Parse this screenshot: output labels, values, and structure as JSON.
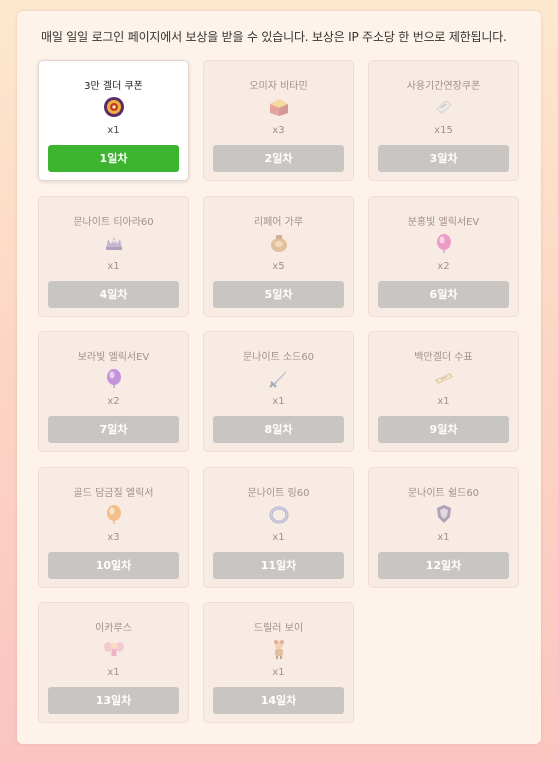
{
  "notice": "매일 일일 로그인 페이지에서 보상을 받을 수 있습니다. 보상은 IP 주소당 한 번으로 제한됩니다.",
  "colors": {
    "active_button": "#3cb430",
    "inactive_button": "#c9c5c3"
  },
  "rewards": [
    {
      "name": "3만 겔더 쿠폰",
      "qty": "x1",
      "day": "1일차",
      "icon": "coupon-icon",
      "active": true
    },
    {
      "name": "오미자 비타민",
      "qty": "x3",
      "day": "2일차",
      "icon": "vitamin-box-icon",
      "active": false
    },
    {
      "name": "사용기간연장쿠폰",
      "qty": "x15",
      "day": "3일차",
      "icon": "ticket-icon",
      "active": false
    },
    {
      "name": "문나이트 티아라60",
      "qty": "x1",
      "day": "4일차",
      "icon": "tiara-icon",
      "active": false
    },
    {
      "name": "리페어 가루",
      "qty": "x5",
      "day": "5일차",
      "icon": "powder-bag-icon",
      "active": false
    },
    {
      "name": "분홍빛 엘릭서EV",
      "qty": "x2",
      "day": "6일차",
      "icon": "pink-gem-icon",
      "active": false
    },
    {
      "name": "보라빛 엘릭서EV",
      "qty": "x2",
      "day": "7일차",
      "icon": "purple-balloon-icon",
      "active": false
    },
    {
      "name": "문나이트 소드60",
      "qty": "x1",
      "day": "8일차",
      "icon": "sword-icon",
      "active": false
    },
    {
      "name": "백만겔더 수표",
      "qty": "x1",
      "day": "9일차",
      "icon": "cheque-icon",
      "active": false
    },
    {
      "name": "골드 담금질 엘릭서",
      "qty": "x3",
      "day": "10일차",
      "icon": "gold-elixir-icon",
      "active": false
    },
    {
      "name": "문나이트 링60",
      "qty": "x1",
      "day": "11일차",
      "icon": "ring-icon",
      "active": false
    },
    {
      "name": "문나이트 쉴드60",
      "qty": "x1",
      "day": "12일차",
      "icon": "shield-icon",
      "active": false
    },
    {
      "name": "이카루스",
      "qty": "x1",
      "day": "13일차",
      "icon": "icarus-icon",
      "active": false
    },
    {
      "name": "드릴러 보이",
      "qty": "x1",
      "day": "14일차",
      "icon": "driller-boy-icon",
      "active": false
    }
  ]
}
